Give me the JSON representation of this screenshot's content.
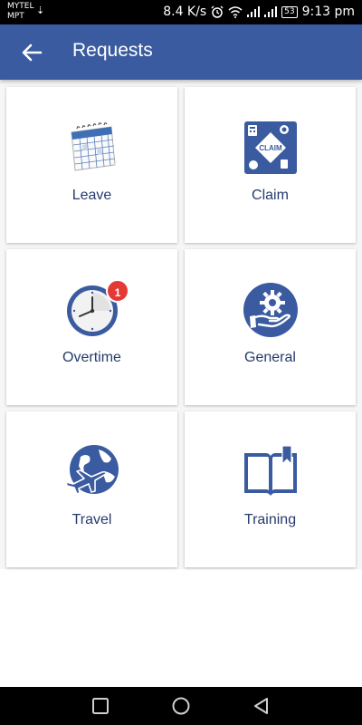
{
  "status_bar": {
    "carrier_line1": "MYTEL",
    "carrier_line2": "MPT",
    "speed": "8.4 K/s",
    "battery": "53",
    "time": "9:13 pm"
  },
  "app_bar": {
    "title": "Requests",
    "back_icon": "arrow-left-icon"
  },
  "colors": {
    "primary": "#3a5ba0",
    "label": "#253b6e",
    "badge": "#e53935"
  },
  "tiles": [
    {
      "label": "Leave",
      "icon": "calendar-icon"
    },
    {
      "label": "Claim",
      "icon": "claim-icon",
      "icon_text": "CLAIM"
    },
    {
      "label": "Overtime",
      "icon": "clock-icon",
      "badge": "1"
    },
    {
      "label": "General",
      "icon": "gear-hand-icon"
    },
    {
      "label": "Travel",
      "icon": "globe-plane-icon"
    },
    {
      "label": "Training",
      "icon": "book-icon"
    }
  ],
  "nav_bar": [
    "recents-square-icon",
    "home-circle-icon",
    "back-triangle-icon"
  ]
}
